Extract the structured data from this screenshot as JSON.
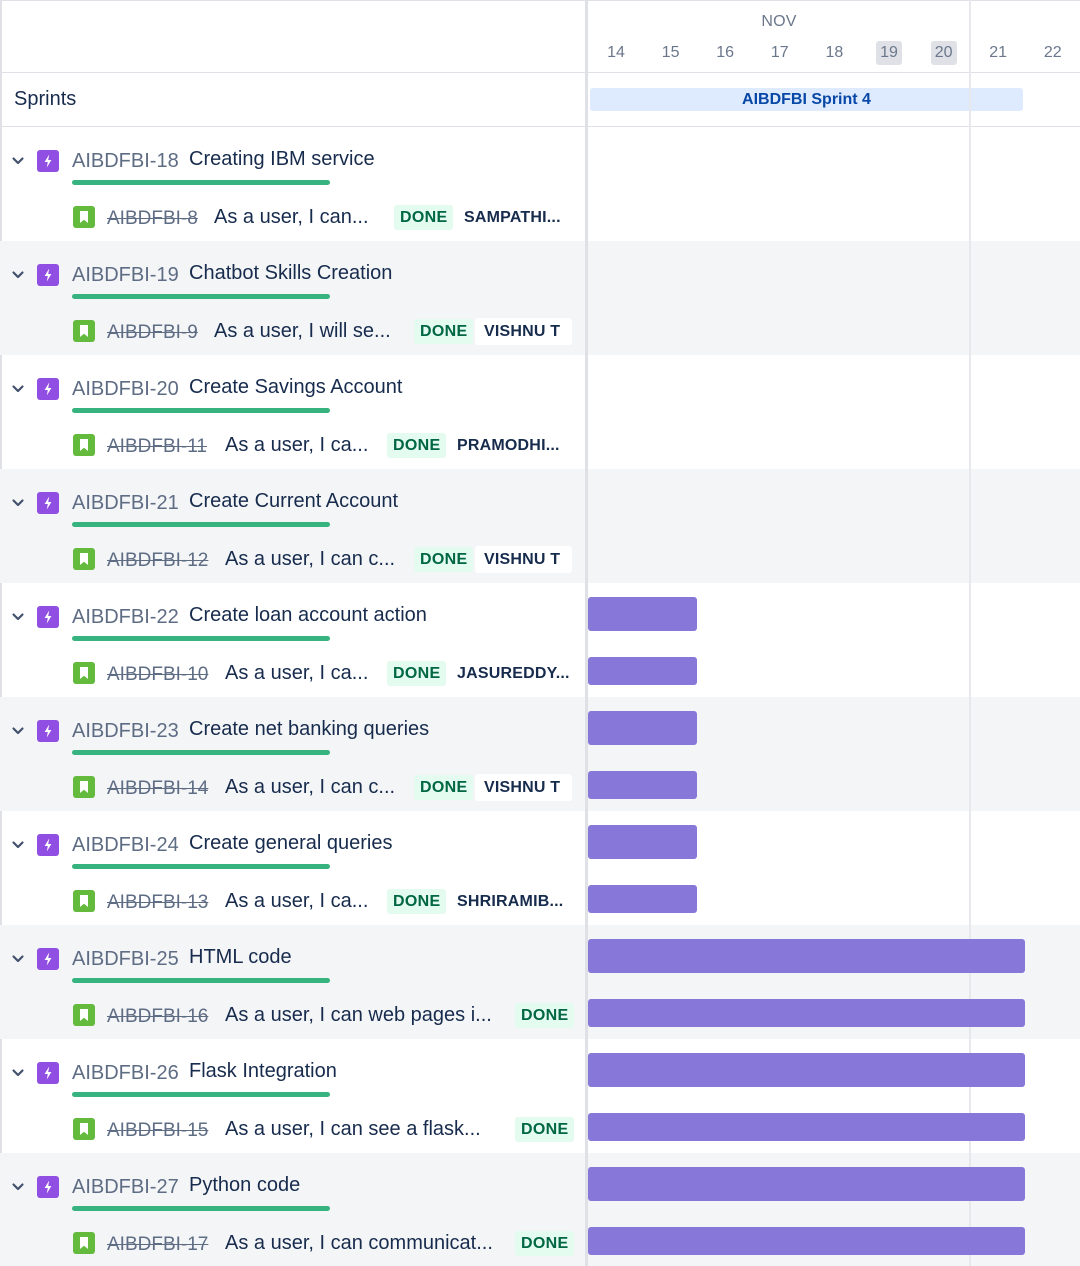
{
  "timeline": {
    "month": "NOV",
    "days": [
      {
        "label": "14",
        "weekend": false
      },
      {
        "label": "15",
        "weekend": false
      },
      {
        "label": "16",
        "weekend": false
      },
      {
        "label": "17",
        "weekend": false
      },
      {
        "label": "18",
        "weekend": false
      },
      {
        "label": "19",
        "weekend": true
      },
      {
        "label": "20",
        "weekend": true
      },
      {
        "label": "21",
        "weekend": false
      },
      {
        "label": "22",
        "weekend": false
      }
    ]
  },
  "sprints": {
    "label": "Sprints",
    "sprint_name": "AIBDFBI Sprint 4"
  },
  "colors": {
    "epic": "#904ee2",
    "story": "#63ba3c",
    "bar": "#8777d9",
    "progress": "#36b37e",
    "done_bg": "#e3fcef",
    "done_text": "#006644",
    "sprint_bg": "#deebff"
  },
  "epics": [
    {
      "key": "AIBDFBI-18",
      "title": "Creating IBM service",
      "epic_bar": null,
      "story": {
        "key": "AIBDFBI-8",
        "summary": "As a user, I can...",
        "status": "DONE",
        "assignee": "SAMPATHI...",
        "bar": null
      }
    },
    {
      "key": "AIBDFBI-19",
      "title": "Chatbot Skills Creation",
      "epic_bar": null,
      "story": {
        "key": "AIBDFBI-9",
        "summary": "As a user, I will se...",
        "status": "DONE",
        "assignee": "VISHNU T",
        "bar": null
      }
    },
    {
      "key": "AIBDFBI-20",
      "title": "Create Savings Account",
      "epic_bar": null,
      "story": {
        "key": "AIBDFBI-11",
        "summary": "As a user, I ca...",
        "status": "DONE",
        "assignee": "PRAMODHI...",
        "bar": null
      }
    },
    {
      "key": "AIBDFBI-21",
      "title": "Create Current Account",
      "epic_bar": null,
      "story": {
        "key": "AIBDFBI-12",
        "summary": "As a user, I can c...",
        "status": "DONE",
        "assignee": "VISHNU T",
        "bar": null
      }
    },
    {
      "key": "AIBDFBI-22",
      "title": "Create loan account action",
      "epic_bar": {
        "start": "14",
        "end": "15"
      },
      "story": {
        "key": "AIBDFBI-10",
        "summary": "As a user, I ca...",
        "status": "DONE",
        "assignee": "JASUREDDY...",
        "bar": {
          "start": "14",
          "end": "15"
        }
      }
    },
    {
      "key": "AIBDFBI-23",
      "title": "Create net banking queries",
      "epic_bar": {
        "start": "14",
        "end": "15"
      },
      "story": {
        "key": "AIBDFBI-14",
        "summary": "As a user, I can c...",
        "status": "DONE",
        "assignee": "VISHNU T",
        "bar": {
          "start": "14",
          "end": "15"
        }
      }
    },
    {
      "key": "AIBDFBI-24",
      "title": "Create general queries",
      "epic_bar": {
        "start": "14",
        "end": "15"
      },
      "story": {
        "key": "AIBDFBI-13",
        "summary": "As a user, I ca...",
        "status": "DONE",
        "assignee": "SHRIRAMIB...",
        "bar": {
          "start": "14",
          "end": "15"
        }
      }
    },
    {
      "key": "AIBDFBI-25",
      "title": "HTML code",
      "epic_bar": {
        "start": "14",
        "end": "21"
      },
      "story": {
        "key": "AIBDFBI-16",
        "summary": "As a user, I can web pages i...",
        "status": "DONE",
        "assignee": null,
        "bar": {
          "start": "14",
          "end": "21"
        }
      }
    },
    {
      "key": "AIBDFBI-26",
      "title": "Flask Integration",
      "epic_bar": {
        "start": "14",
        "end": "21"
      },
      "story": {
        "key": "AIBDFBI-15",
        "summary": "As a user, I can see a flask...",
        "status": "DONE",
        "assignee": null,
        "bar": {
          "start": "14",
          "end": "21"
        }
      }
    },
    {
      "key": "AIBDFBI-27",
      "title": "Python code",
      "epic_bar": {
        "start": "14",
        "end": "21"
      },
      "story": {
        "key": "AIBDFBI-17",
        "summary": "As a user, I can communicat...",
        "status": "DONE",
        "assignee": null,
        "bar": {
          "start": "14",
          "end": "21"
        }
      }
    }
  ]
}
